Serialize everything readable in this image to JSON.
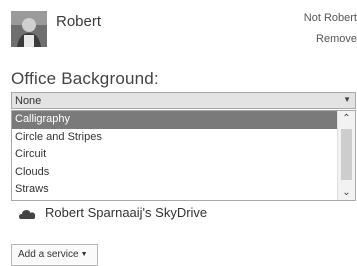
{
  "account": {
    "name": "Robert",
    "not_user": "Not Robert",
    "remove": "Remove"
  },
  "background": {
    "heading": "Office Background:",
    "selected_value": "None",
    "options": [
      "Calligraphy",
      "Circle and Stripes",
      "Circuit",
      "Clouds",
      "Straws"
    ],
    "highlighted": "Calligraphy"
  },
  "services": {
    "skydrive_label": "Robert Sparnaaij's SkyDrive",
    "add_service_label": "Add a service"
  },
  "icons": {
    "scroll_up": "chevron-up-icon",
    "scroll_down": "chevron-down-icon",
    "dropdown": "caret-down-icon",
    "cloud": "cloud-icon"
  }
}
